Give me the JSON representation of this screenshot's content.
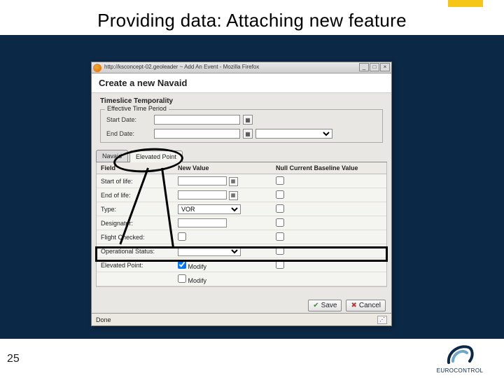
{
  "slide": {
    "title": "Providing data: Attaching new feature",
    "page_number": "25",
    "logo_text": "EUROCONTROL"
  },
  "window": {
    "url_text": "http://ksconcept-02.geoleader ~ Add An Event - Mozilla Firefox",
    "heading": "Create a new Navaid",
    "section_title": "Timeslice Temporality",
    "fieldset_legend": "Effective Time Period",
    "start_label": "Start Date:",
    "end_label": "End Date:",
    "end_select_value": "",
    "tabs": {
      "navaid": "Navaid",
      "elevated": "Elevated Point"
    },
    "grid_headers": {
      "field": "Field",
      "newval": "New Value",
      "null": "Null Current Baseline Value"
    },
    "rows": {
      "start_life": "Start of life:",
      "end_life": "End of life:",
      "type": "Type:",
      "type_value": "VOR",
      "designator": "Designator:",
      "flight_checked": "Flight Checked:",
      "operational_status": "Operational Status:",
      "elevated_point": "Elevated Point:",
      "modify": "Modify"
    },
    "buttons": {
      "save": "Save",
      "cancel": "Cancel"
    },
    "status_text": "Done"
  }
}
